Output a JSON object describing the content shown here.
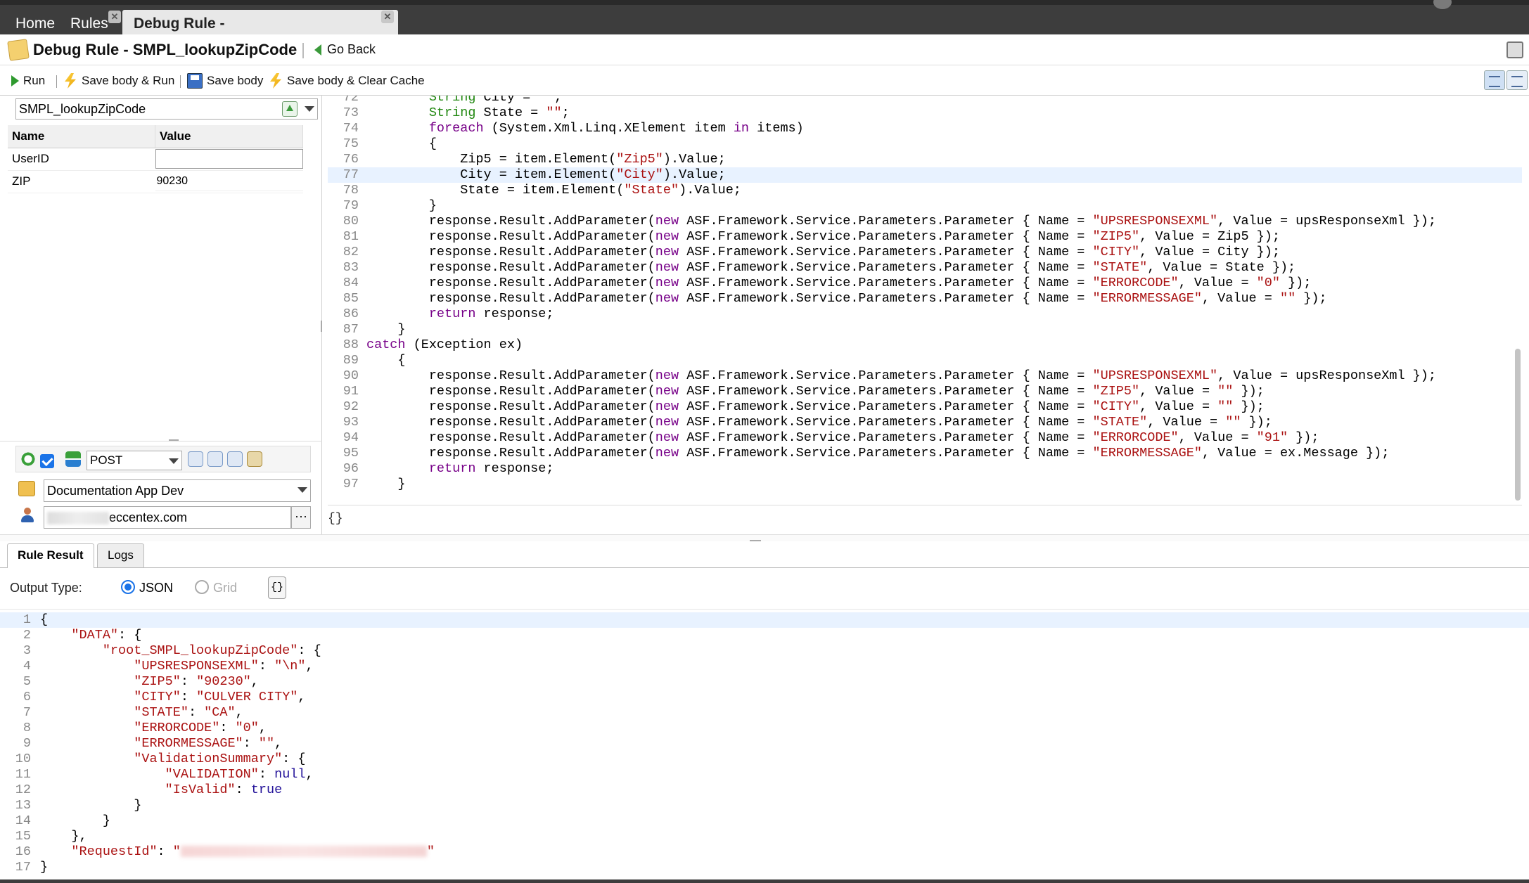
{
  "tabs": {
    "home": "Home",
    "rules": "Rules",
    "active": "Debug Rule - SMPL_lookupZipCode",
    "close_glyph": "✕"
  },
  "header": {
    "title": "Debug Rule - SMPL_lookupZipCode",
    "go_back": "Go Back"
  },
  "toolbar": {
    "run": "Run",
    "save_body_run": "Save body & Run",
    "save_body": "Save body",
    "save_body_clear_cache": "Save body & Clear Cache"
  },
  "left": {
    "rule_name": "SMPL_lookupZipCode",
    "params_header": {
      "name": "Name",
      "value": "Value"
    },
    "params": [
      {
        "name": "UserID",
        "value": ""
      },
      {
        "name": "ZIP",
        "value": "90230"
      }
    ],
    "method": "POST",
    "app": "Documentation App Dev",
    "user_domain": "eccentex.com",
    "more": "···"
  },
  "editor": {
    "status_braces": "{}",
    "highlight_line": 77,
    "lines": [
      {
        "n": "72",
        "t": "        String City = \"\";"
      },
      {
        "n": "73",
        "t": "        String State = \"\";"
      },
      {
        "n": "74",
        "t": "        foreach (System.Xml.Linq.XElement item in items)"
      },
      {
        "n": "75",
        "t": "        {"
      },
      {
        "n": "76",
        "t": "            Zip5 = item.Element(\"Zip5\").Value;"
      },
      {
        "n": "77",
        "t": "            City = item.Element(\"City\").Value;"
      },
      {
        "n": "78",
        "t": "            State = item.Element(\"State\").Value;"
      },
      {
        "n": "79",
        "t": "        }"
      },
      {
        "n": "80",
        "t": "        response.Result.AddParameter(new ASF.Framework.Service.Parameters.Parameter { Name = \"UPSRESPONSEXML\", Value = upsResponseXml });"
      },
      {
        "n": "81",
        "t": "        response.Result.AddParameter(new ASF.Framework.Service.Parameters.Parameter { Name = \"ZIP5\", Value = Zip5 });"
      },
      {
        "n": "82",
        "t": "        response.Result.AddParameter(new ASF.Framework.Service.Parameters.Parameter { Name = \"CITY\", Value = City });"
      },
      {
        "n": "83",
        "t": "        response.Result.AddParameter(new ASF.Framework.Service.Parameters.Parameter { Name = \"STATE\", Value = State });"
      },
      {
        "n": "84",
        "t": "        response.Result.AddParameter(new ASF.Framework.Service.Parameters.Parameter { Name = \"ERRORCODE\", Value = \"0\" });"
      },
      {
        "n": "85",
        "t": "        response.Result.AddParameter(new ASF.Framework.Service.Parameters.Parameter { Name = \"ERRORMESSAGE\", Value = \"\" });"
      },
      {
        "n": "86",
        "t": "        return response;"
      },
      {
        "n": "87",
        "t": "    }"
      },
      {
        "n": "88",
        "t": "catch (Exception ex)"
      },
      {
        "n": "89",
        "t": "    {"
      },
      {
        "n": "90",
        "t": "        response.Result.AddParameter(new ASF.Framework.Service.Parameters.Parameter { Name = \"UPSRESPONSEXML\", Value = upsResponseXml });"
      },
      {
        "n": "91",
        "t": "        response.Result.AddParameter(new ASF.Framework.Service.Parameters.Parameter { Name = \"ZIP5\", Value = \"\" });"
      },
      {
        "n": "92",
        "t": "        response.Result.AddParameter(new ASF.Framework.Service.Parameters.Parameter { Name = \"CITY\", Value = \"\" });"
      },
      {
        "n": "93",
        "t": "        response.Result.AddParameter(new ASF.Framework.Service.Parameters.Parameter { Name = \"STATE\", Value = \"\" });"
      },
      {
        "n": "94",
        "t": "        response.Result.AddParameter(new ASF.Framework.Service.Parameters.Parameter { Name = \"ERRORCODE\", Value = \"91\" });"
      },
      {
        "n": "95",
        "t": "        response.Result.AddParameter(new ASF.Framework.Service.Parameters.Parameter { Name = \"ERRORMESSAGE\", Value = ex.Message });"
      },
      {
        "n": "96",
        "t": "        return response;"
      },
      {
        "n": "97",
        "t": "    }"
      }
    ]
  },
  "result": {
    "tabs": {
      "rule_result": "Rule Result",
      "logs": "Logs"
    },
    "output_type_label": "Output Type:",
    "json_label": "JSON",
    "grid_label": "Grid",
    "format_btn": "{}",
    "lines": [
      {
        "n": "1",
        "t": "{"
      },
      {
        "n": "2",
        "t": "    \"DATA\": {"
      },
      {
        "n": "3",
        "t": "        \"root_SMPL_lookupZipCode\": {"
      },
      {
        "n": "4",
        "t": "            \"UPSRESPONSEXML\": \"\\n\","
      },
      {
        "n": "5",
        "t": "            \"ZIP5\": \"90230\","
      },
      {
        "n": "6",
        "t": "            \"CITY\": \"CULVER CITY\","
      },
      {
        "n": "7",
        "t": "            \"STATE\": \"CA\","
      },
      {
        "n": "8",
        "t": "            \"ERRORCODE\": \"0\","
      },
      {
        "n": "9",
        "t": "            \"ERRORMESSAGE\": \"\","
      },
      {
        "n": "10",
        "t": "            \"ValidationSummary\": {"
      },
      {
        "n": "11",
        "t": "                \"VALIDATION\": null,"
      },
      {
        "n": "12",
        "t": "                \"IsValid\": true"
      },
      {
        "n": "13",
        "t": "            }"
      },
      {
        "n": "14",
        "t": "        }"
      },
      {
        "n": "15",
        "t": "    },"
      },
      {
        "n": "16",
        "t": "    \"RequestId\": \"\""
      },
      {
        "n": "17",
        "t": "}"
      }
    ]
  },
  "colors": {
    "tabbar": "#3d3d3d",
    "keyword": "#770088",
    "type_keyword": "#228811",
    "string": "#aa1111",
    "atom": "#221199",
    "accent": "#1a73e8"
  }
}
